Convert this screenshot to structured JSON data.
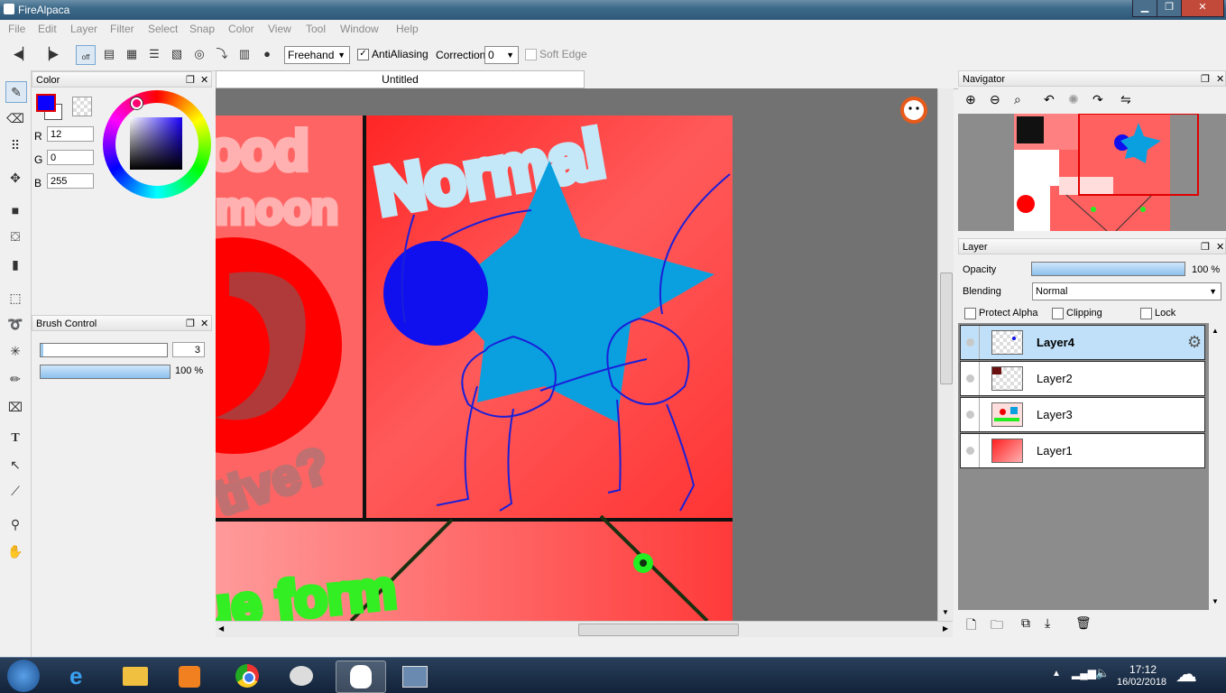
{
  "window": {
    "title": "FireAlpaca"
  },
  "menu": [
    "File",
    "Edit",
    "Layer",
    "Filter",
    "Select",
    "Snap",
    "Color",
    "View",
    "Tool",
    "Window",
    "Help"
  ],
  "toolbar": {
    "brush_mode": "Freehand",
    "antialiasing_label": "AntiAliasing",
    "antialiasing_checked": true,
    "correction_label": "Correction",
    "correction_value": "0",
    "soft_edge_label": "Soft Edge",
    "snap_off_label": "off"
  },
  "color_panel": {
    "title": "Color",
    "r_label": "R",
    "g_label": "G",
    "b_label": "B",
    "r": "12",
    "g": "0",
    "b": "255",
    "primary_color": "#0c00ff"
  },
  "brush_panel": {
    "title": "Brush Control",
    "size": "3",
    "opacity": "100 %"
  },
  "document": {
    "tab": "Untitled"
  },
  "navigator": {
    "title": "Navigator"
  },
  "layer_panel": {
    "title": "Layer",
    "opacity_label": "Opacity",
    "opacity_value": "100 %",
    "blending_label": "Blending",
    "blending_value": "Normal",
    "protect_alpha": "Protect Alpha",
    "clipping": "Clipping",
    "lock": "Lock",
    "layers": [
      {
        "name": "Layer4",
        "selected": true
      },
      {
        "name": "Layer2",
        "selected": false
      },
      {
        "name": "Layer3",
        "selected": false
      },
      {
        "name": "Layer1",
        "selected": false
      }
    ]
  },
  "taskbar": {
    "time": "17:12",
    "date": "16/02/2018"
  },
  "colors": {
    "accent_selected": "#bfe0f8",
    "canvas_bg": "#727272",
    "title_bar": "#3d6a8a"
  }
}
